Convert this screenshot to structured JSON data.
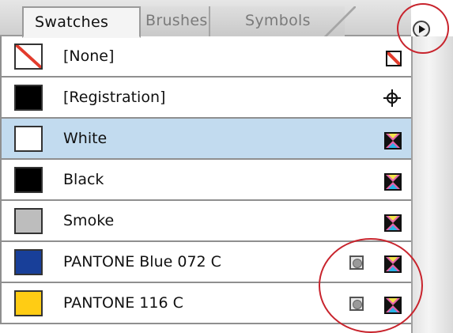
{
  "tabs": [
    {
      "label": "Swatches",
      "active": true
    },
    {
      "label": "Brushes",
      "active": false
    },
    {
      "label": "Symbols",
      "active": false
    }
  ],
  "panel_menu_icon": "panel-menu-arrow-icon",
  "swatches": [
    {
      "name": "[None]",
      "chip_color": "none",
      "right_icon": "none-icon",
      "selected": false
    },
    {
      "name": "[Registration]",
      "chip_color": "#000000",
      "right_icon": "registration-icon",
      "selected": false
    },
    {
      "name": "White",
      "chip_color": "#ffffff",
      "right_icon": "process-color-icon",
      "selected": true
    },
    {
      "name": "Black",
      "chip_color": "#000000",
      "right_icon": "process-color-icon",
      "selected": false
    },
    {
      "name": "Smoke",
      "chip_color": "#bdbdbd",
      "right_icon": "process-color-icon",
      "selected": false
    },
    {
      "name": "PANTONE Blue 072 C",
      "chip_color": "#183f99",
      "right_icon": "process-color-icon",
      "spot_icon": "spot-color-icon",
      "selected": false
    },
    {
      "name": "PANTONE 116 C",
      "chip_color": "#ffcc14",
      "right_icon": "process-color-icon",
      "spot_icon": "spot-color-icon",
      "selected": false
    }
  ],
  "colors": {
    "selection": "#c2dbef",
    "annotation_circle": "#c8242d"
  }
}
